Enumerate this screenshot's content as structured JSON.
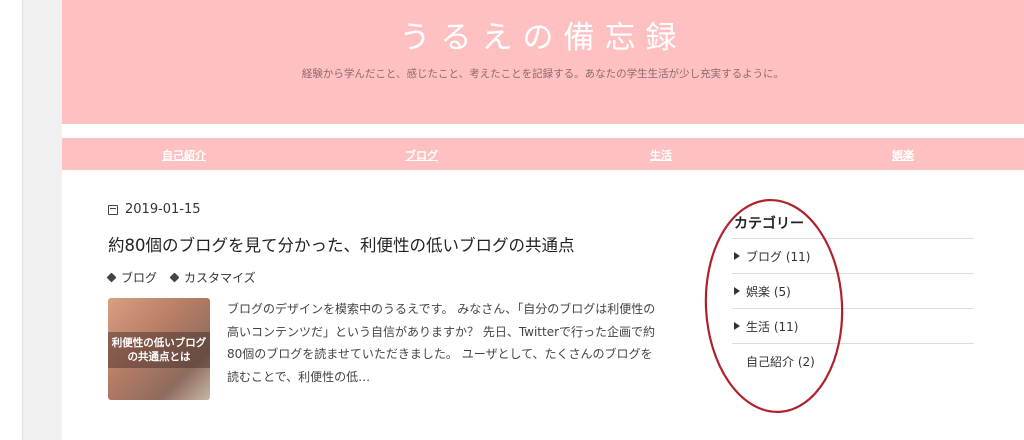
{
  "site": {
    "title": "うるえの備忘録",
    "tagline": "経験から学んだこと、感じたこと、考えたことを記録する。あなたの学生生活が少し充実するように。"
  },
  "nav": {
    "items": [
      {
        "label": "自己紹介"
      },
      {
        "label": "ブログ"
      },
      {
        "label": "生活"
      },
      {
        "label": "娯楽"
      }
    ]
  },
  "post": {
    "date": "2019-01-15",
    "title": "約80個のブログを見て分かった、利便性の低いブログの共通点",
    "tags": [
      "ブログ",
      "カスタマイズ"
    ],
    "thumbnail_text": "利便性の低いブログの共通点とは",
    "excerpt": "ブログのデザインを模索中のうるえです。 みなさん、「自分のブログは利便性の高いコンテンツだ」という自信がありますか？ 先日、Twitterで行った企画で約80個のブログを読ませていただきました。 ユーザとして、たくさんのブログを読むことで、利便性の低…"
  },
  "sidebar": {
    "heading": "カテゴリー",
    "categories": [
      {
        "label": "ブログ (11)",
        "expandable": true
      },
      {
        "label": "娯楽 (5)",
        "expandable": true
      },
      {
        "label": "生活 (11)",
        "expandable": true
      },
      {
        "label": "自己紹介 (2)",
        "expandable": false
      }
    ]
  },
  "colors": {
    "header_bg": "#ffc0c2",
    "annotation": "#b0222b"
  }
}
